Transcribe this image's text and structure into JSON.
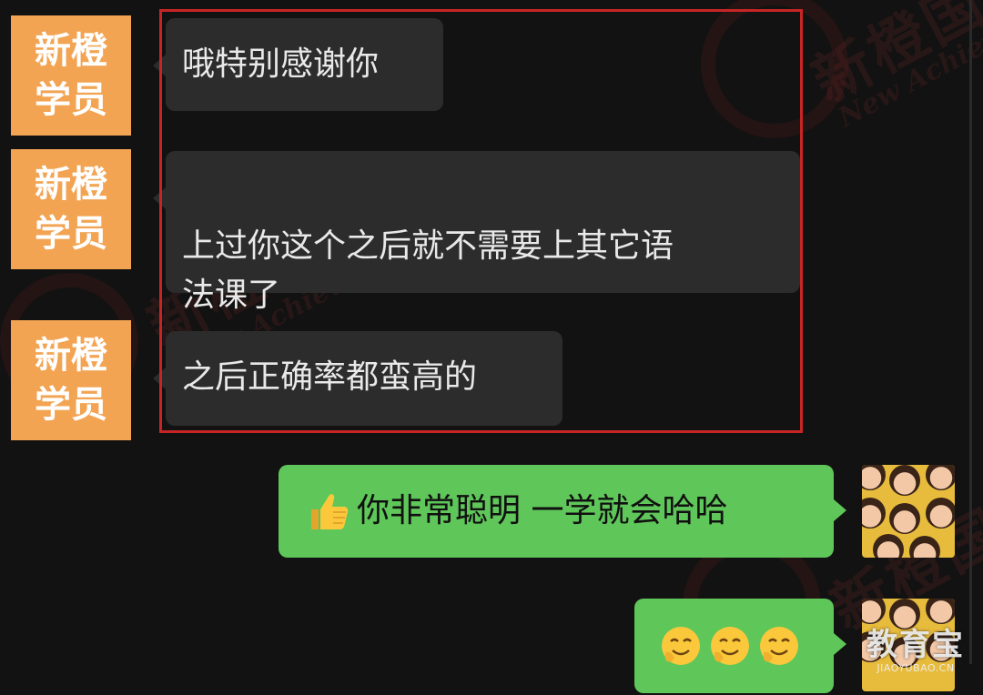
{
  "watermark": {
    "cn": "新橙国际",
    "en": "New Achievements"
  },
  "messages": [
    {
      "side": "left",
      "avatar_text": "新橙\n学员",
      "text": "哦特别感谢你"
    },
    {
      "side": "left",
      "avatar_text": "新橙\n学员",
      "text": "上过你这个之后就不需要上其它语\n法课了"
    },
    {
      "side": "left",
      "avatar_text": "新橙\n学员",
      "text": "之后正确率都蛮高的"
    },
    {
      "side": "right",
      "emoji": "thumbs-up",
      "text": "你非常聪明 一学就会哈哈"
    },
    {
      "side": "right",
      "emoji": "smiling-face-x3",
      "text": ""
    }
  ],
  "brand": {
    "cn": "教育宝",
    "en": "JIAOYUBAO.CN"
  },
  "colors": {
    "background": "#121212",
    "left_bubble": "#2c2c2c",
    "right_bubble": "#5fc65a",
    "avatar_orange": "#f2a453",
    "highlight": "#c72525"
  }
}
